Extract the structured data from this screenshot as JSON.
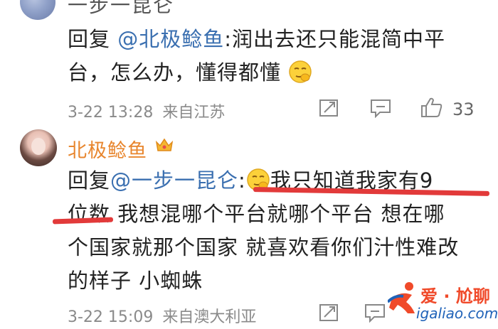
{
  "comment1": {
    "username": "一步一昆仑",
    "reply_prefix": "回复 ",
    "mention": "@北极鲶鱼",
    "text_line1_rest": ":润出去还只能混简中平",
    "text_line2": "台，怎么办，懂得都懂",
    "timestamp": "3-22 13:28",
    "location": "来自江苏",
    "like_count": "33"
  },
  "comment2": {
    "username": "北极鲶鱼",
    "reply_prefix": "回复",
    "mention": "@一步一昆仑",
    "colon": ":",
    "text_line1_rest": "我只知道我家有9",
    "text_line2_a": "位数",
    "text_line2_b": " 我想混哪个平台就哪个平台 想在哪",
    "text_line3": "个国家就那个国家 就喜欢看你们汁性难改",
    "text_line4": "的样子 小蜘蛛",
    "timestamp": "3-22 15:09",
    "location": "来自澳大利亚"
  },
  "watermark": {
    "cn": "爱 · 尬聊",
    "url": "igaliao.com"
  },
  "colors": {
    "mention": "#3a6fb0",
    "vip_name": "#e8862e",
    "underline": "#e23a3a",
    "meta": "#8a8a8a"
  },
  "icons": [
    "share-icon",
    "comment-icon",
    "like-icon",
    "vip-crown-icon",
    "smirk-emoji"
  ]
}
